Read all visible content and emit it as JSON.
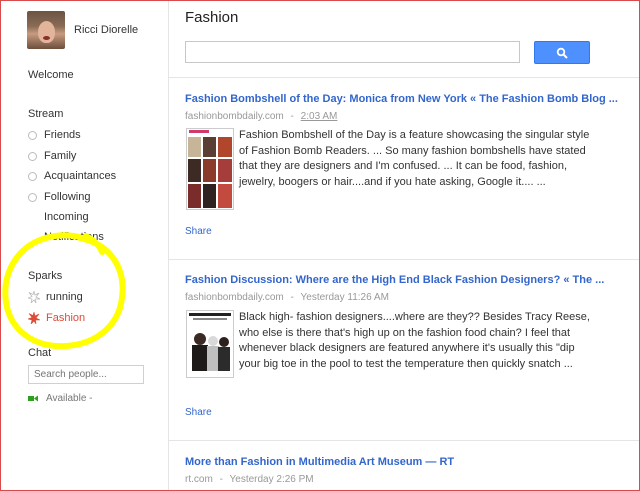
{
  "profile": {
    "name": "Ricci Diorelle"
  },
  "nav": {
    "welcome": "Welcome",
    "stream_label": "Stream",
    "stream_items": [
      "Friends",
      "Family",
      "Acquaintances",
      "Following"
    ],
    "incoming": "Incoming",
    "notifications": "Notifications",
    "sparks_label": "Sparks",
    "sparks": [
      "running",
      "Fashion"
    ],
    "chat_label": "Chat",
    "chat_placeholder": "Search people...",
    "availability": "Available -"
  },
  "main": {
    "title": "Fashion",
    "search_value": "",
    "posts": [
      {
        "title": "Fashion Bombshell of the Day: Monica from New York « The Fashion Bomb Blog ...",
        "source": "fashionbombdaily.com",
        "sep": "-",
        "time": "2:03 AM",
        "body": "Fashion Bombshell of the Day is a feature showcasing the singular style of Fashion Bomb Readers. ... So many fashion bombshells have stated that they are designers and I'm confused. ... It can be food, fashion, jewelry, boogers or hair....and if you hate asking, Google it.... ...",
        "share": "Share"
      },
      {
        "title": "Fashion Discussion: Where are the High End Black Fashion Designers? « The ...",
        "source": "fashionbombdaily.com",
        "sep": "-",
        "time": "Yesterday 11:26 AM",
        "body": "Black high- fashion designers....where are they?? Besides Tracy Reese, who else is there that's high up on the fashion food chain? I feel that whenever black designers are featured anywhere it's usually this \"dip your big toe in the pool to test the temperature then quickly snatch ...",
        "share": "Share"
      },
      {
        "title": "More than Fashion in Multimedia Art Museum — RT",
        "source": "rt.com",
        "sep": "-",
        "time": "Yesterday 2:26 PM"
      }
    ]
  },
  "colors": {
    "link": "#3366cc",
    "spark_active": "#dd4b39",
    "search_button": "#4d90fe",
    "highlight": "#ffff00",
    "frame": "#d94b4b"
  }
}
